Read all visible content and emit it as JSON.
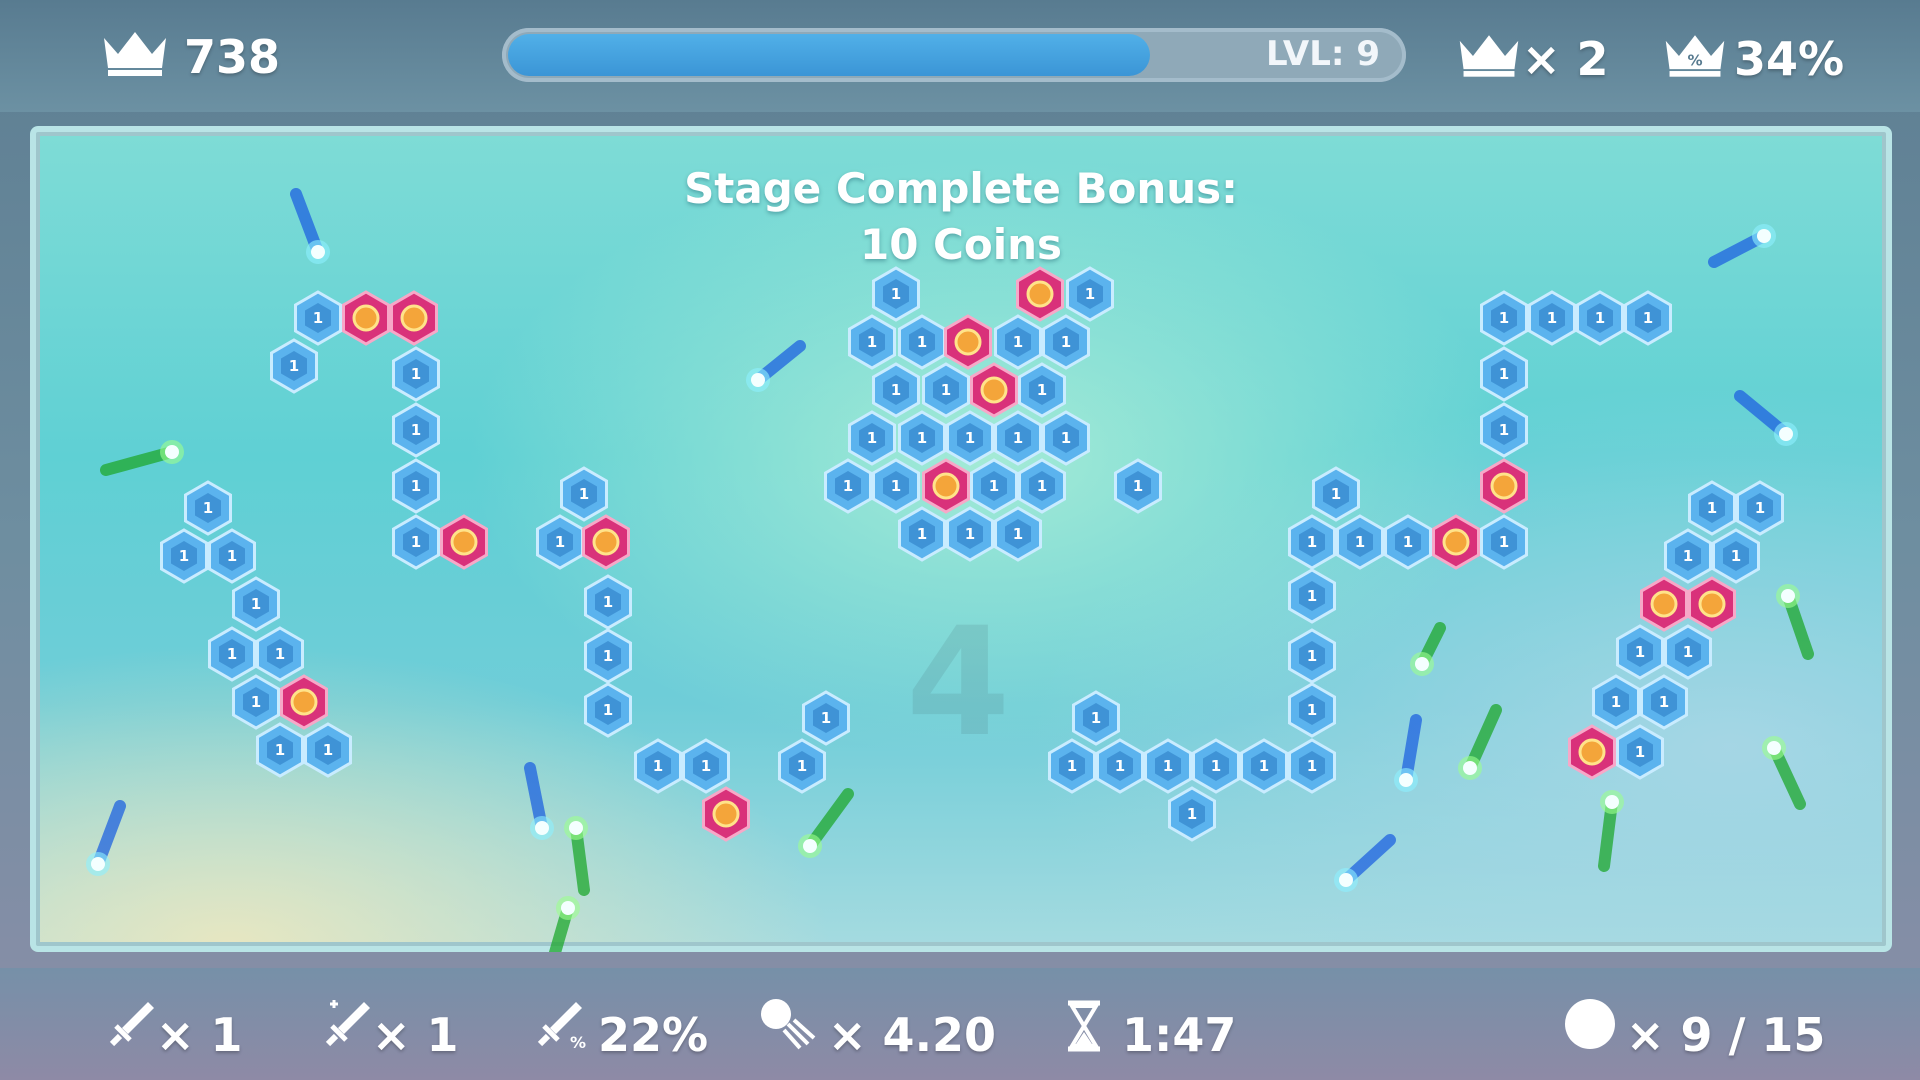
{
  "hud_top": {
    "score": "738",
    "level_label": "LVL: 9",
    "level_progress": 0.72,
    "crown_multiplier": "× 2",
    "crown_percent": "34%"
  },
  "board": {
    "bonus_line1": "Stage Complete Bonus:",
    "bonus_line2": "10 Coins",
    "ghost_number": "4",
    "brick_value": "1"
  },
  "hud_bottom": {
    "sword_count": "× 1",
    "sword_plus_count": "× 1",
    "crit_chance": "22%",
    "ball_speed": "× 4.20",
    "timer": "1:47",
    "balls": "× 9 / 15"
  },
  "colors": {
    "blue_brick": "#5bb3ee",
    "coin_brick": "#d9317a",
    "blue_ball": "#1f63e0",
    "green_ball": "#1fa82e",
    "xp_fill": "#4aa6e2"
  },
  "icons": [
    "crown-icon",
    "crown-x-icon",
    "crown-percent-icon",
    "sword-icon",
    "sword-plus-icon",
    "sword-percent-icon",
    "ball-speed-icon",
    "hourglass-icon",
    "ball-icon"
  ]
}
